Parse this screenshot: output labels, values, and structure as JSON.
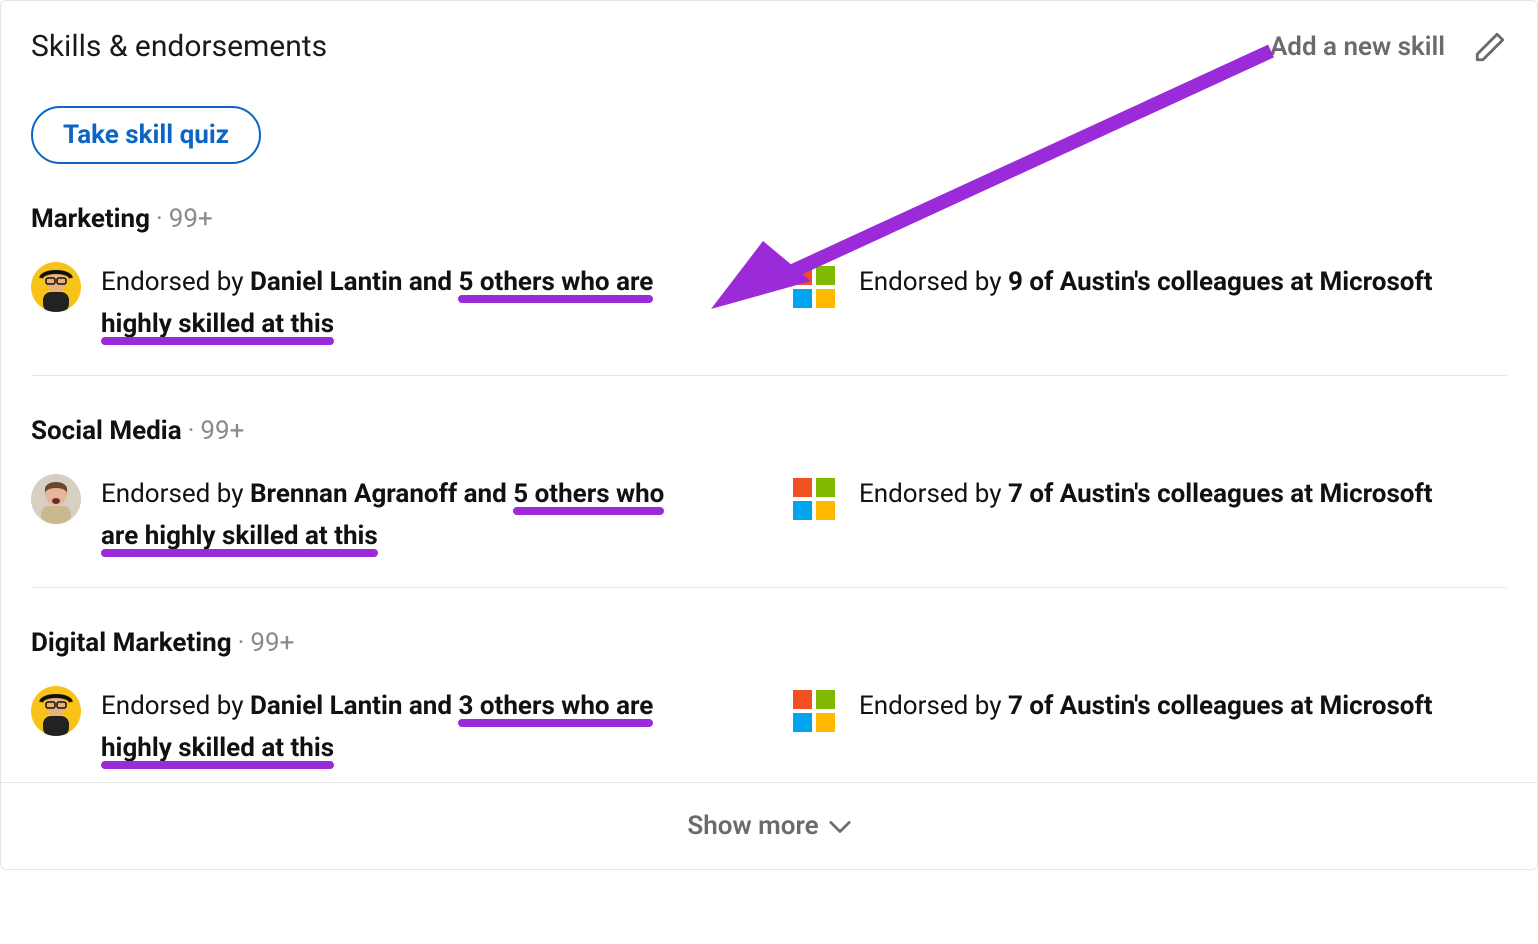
{
  "header": {
    "title": "Skills & endorsements",
    "add_link": "Add a new skill",
    "quiz_button": "Take skill quiz"
  },
  "skills": [
    {
      "name": "Marketing",
      "count_label": "99+",
      "endorser_text_lead": "Endorsed by ",
      "endorser_text_bold_part1": "Daniel Lantin and ",
      "endorser_text_bold_ul1": "5 others who are",
      "endorser_text_bold_ul2": "highly skilled at this",
      "company_text_lead": "Endorsed by ",
      "company_text_bold": "9 of Austin's colleagues at Microsoft",
      "avatar_type": "daniel"
    },
    {
      "name": "Social Media",
      "count_label": "99+",
      "endorser_text_lead": "Endorsed by ",
      "endorser_text_bold_part1": "Brennan Agranoff and ",
      "endorser_text_bold_ul1": "5 others who",
      "endorser_text_bold_ul2": "are highly skilled at this",
      "company_text_lead": "Endorsed by ",
      "company_text_bold": "7 of Austin's colleagues at Microsoft",
      "avatar_type": "brennan"
    },
    {
      "name": "Digital Marketing",
      "count_label": "99+",
      "endorser_text_lead": "Endorsed by ",
      "endorser_text_bold_part1": "Daniel Lantin and ",
      "endorser_text_bold_ul1": "3 others who are",
      "endorser_text_bold_ul2": "highly skilled at this",
      "company_text_lead": "Endorsed by ",
      "company_text_bold": "7 of Austin's colleagues at Microsoft",
      "avatar_type": "daniel"
    }
  ],
  "footer": {
    "show_more": "Show more"
  },
  "annotation": {
    "underline_color": "#9b2bd8",
    "arrow_color": "#9b2bd8"
  }
}
